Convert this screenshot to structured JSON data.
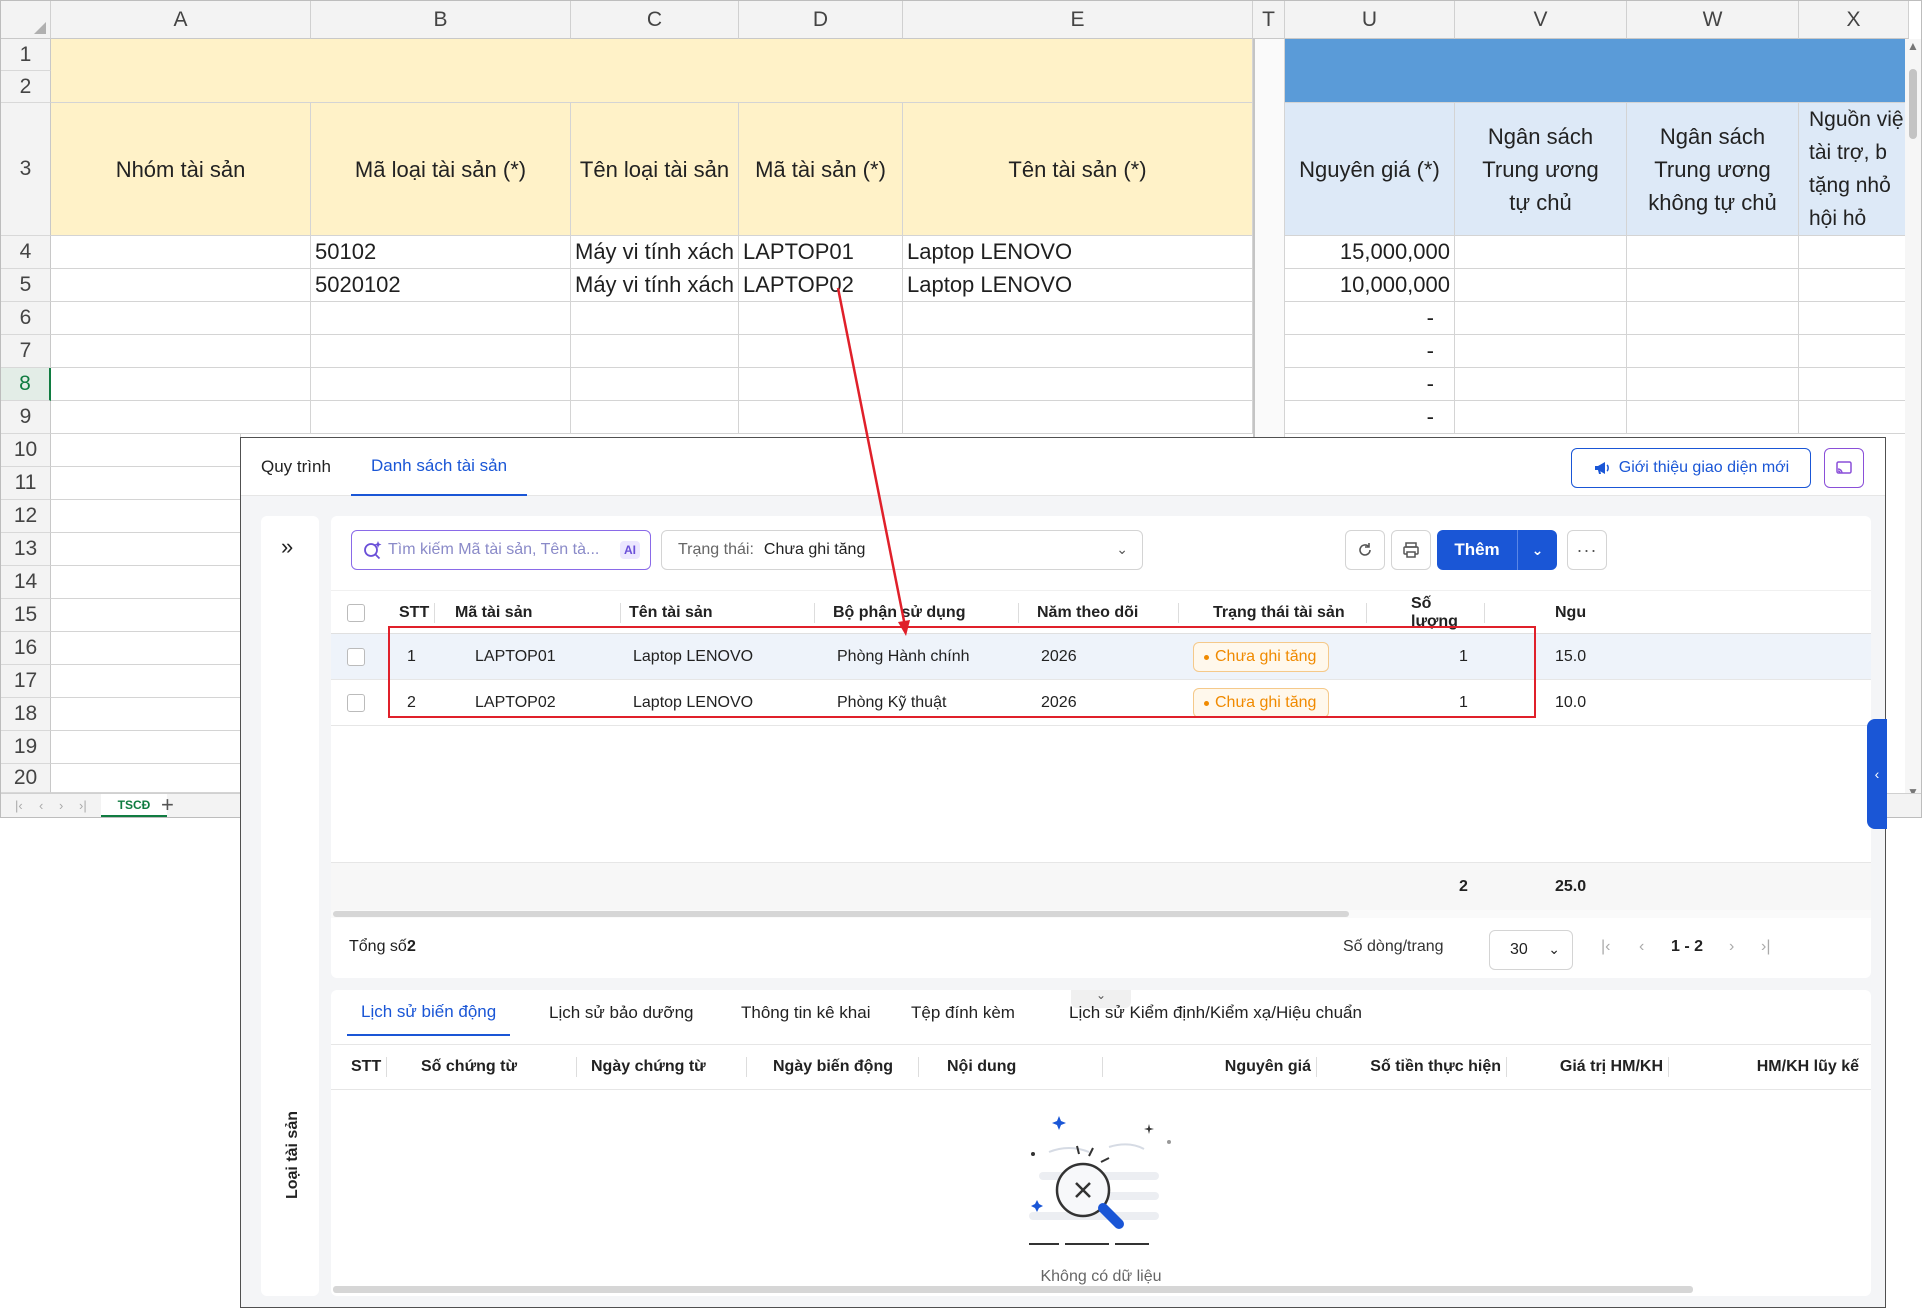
{
  "spreadsheet": {
    "columns": [
      "A",
      "B",
      "C",
      "D",
      "E",
      "T",
      "U",
      "V",
      "W",
      "X"
    ],
    "row_numbers": [
      "1",
      "2",
      "3",
      "4",
      "5",
      "6",
      "7",
      "8",
      "9",
      "10",
      "11",
      "12",
      "13",
      "14",
      "15",
      "16",
      "17",
      "18",
      "19",
      "20"
    ],
    "selected_row": "8",
    "headers": {
      "nhom_tai_san": "Nhóm tài sản",
      "ma_loai": "Mã loại tài sản (*)",
      "ten_loai": "Tên loại tài sản",
      "ma_ts": "Mã tài sản (*)",
      "ten_ts": "Tên tài sản (*)",
      "nguyen_gia": "Nguyên giá (*)",
      "ns_tu_chu": "Ngân sách Trung ương tự chủ",
      "ns_khong_tu_chu": "Ngân sách Trung ương không tự chủ",
      "nguon_vien_tro": "Nguồn việ tài trợ, b tặng nhỏ hội hỏ"
    },
    "rows": [
      {
        "ma_loai": "50102",
        "ten_loai": "Máy vi tính xách",
        "ma_ts": "LAPTOP01",
        "ten_ts": "Laptop LENOVO",
        "nguyen_gia": "15,000,000"
      },
      {
        "ma_loai": "5020102",
        "ten_loai": "Máy vi tính xách",
        "ma_ts": "LAPTOP02",
        "ten_ts": "Laptop LENOVO",
        "nguyen_gia": "10,000,000"
      }
    ],
    "dash_values": [
      "-",
      "-",
      "-",
      "-"
    ],
    "sheet_tab": "TSCĐ",
    "add_sheet": "+",
    "colors": {
      "yellow": "#fff2c8",
      "blue_band": "#5a9bd8",
      "light_blue": "#dde9f7",
      "excel_green": "#107c41"
    }
  },
  "app": {
    "tabs": [
      "Quy trình",
      "Danh sách tài sản"
    ],
    "active_tab": "Danh sách tài sản",
    "intro_button": "Giới thiệu giao diện mới",
    "left_panel_label": "Loại tài sản",
    "expand_icon": "»",
    "search": {
      "placeholder": "Tìm kiếm Mã tài sản, Tên tà...",
      "ai_badge": "AI"
    },
    "status_filter": {
      "label": "Trạng thái:",
      "value": "Chưa ghi tăng"
    },
    "add_button": "Thêm",
    "table": {
      "columns": [
        "STT",
        "Mã tài sản",
        "Tên tài sản",
        "Bộ phận sử dụng",
        "Năm theo dõi",
        "Trạng thái tài sản",
        "Số lượng",
        "Ngu"
      ],
      "rows": [
        {
          "stt": "1",
          "ma": "LAPTOP01",
          "ten": "Laptop LENOVO",
          "bo_phan": "Phòng Hành chính",
          "nam": "2026",
          "trang_thai": "Chưa ghi tăng",
          "so_luong": "1",
          "nguyen_gia": "15.0"
        },
        {
          "stt": "2",
          "ma": "LAPTOP02",
          "ten": "Laptop LENOVO",
          "bo_phan": "Phòng Kỹ thuật",
          "nam": "2026",
          "trang_thai": "Chưa ghi tăng",
          "so_luong": "1",
          "nguyen_gia": "10.0"
        }
      ],
      "summary": {
        "so_luong": "2",
        "nguyen_gia": "25.0"
      }
    },
    "footer": {
      "total_label": "Tổng số:",
      "total_value": "2",
      "page_size_label": "Số dòng/trang",
      "page_size": "30",
      "page_range": "1 - 2"
    },
    "bottom_tabs": [
      "Lịch sử biến động",
      "Lịch sử bảo dưỡng",
      "Thông tin kê khai",
      "Tệp đính kèm",
      "Lịch sử Kiểm định/Kiểm xạ/Hiệu chuẩn"
    ],
    "bottom_active_tab": "Lịch sử biến động",
    "bottom_columns": [
      "STT",
      "Số chứng từ",
      "Ngày chứng từ",
      "Ngày biến động",
      "Nội dung",
      "Nguyên giá",
      "Số tiền thực hiện",
      "Giá trị HM/KH",
      "HM/KH lũy kế"
    ],
    "empty_text": "Không có dữ liệu",
    "colors": {
      "primary": "#1a56d6",
      "badge_orange": "#f08a00",
      "highlight_box": "#e0202a"
    }
  }
}
